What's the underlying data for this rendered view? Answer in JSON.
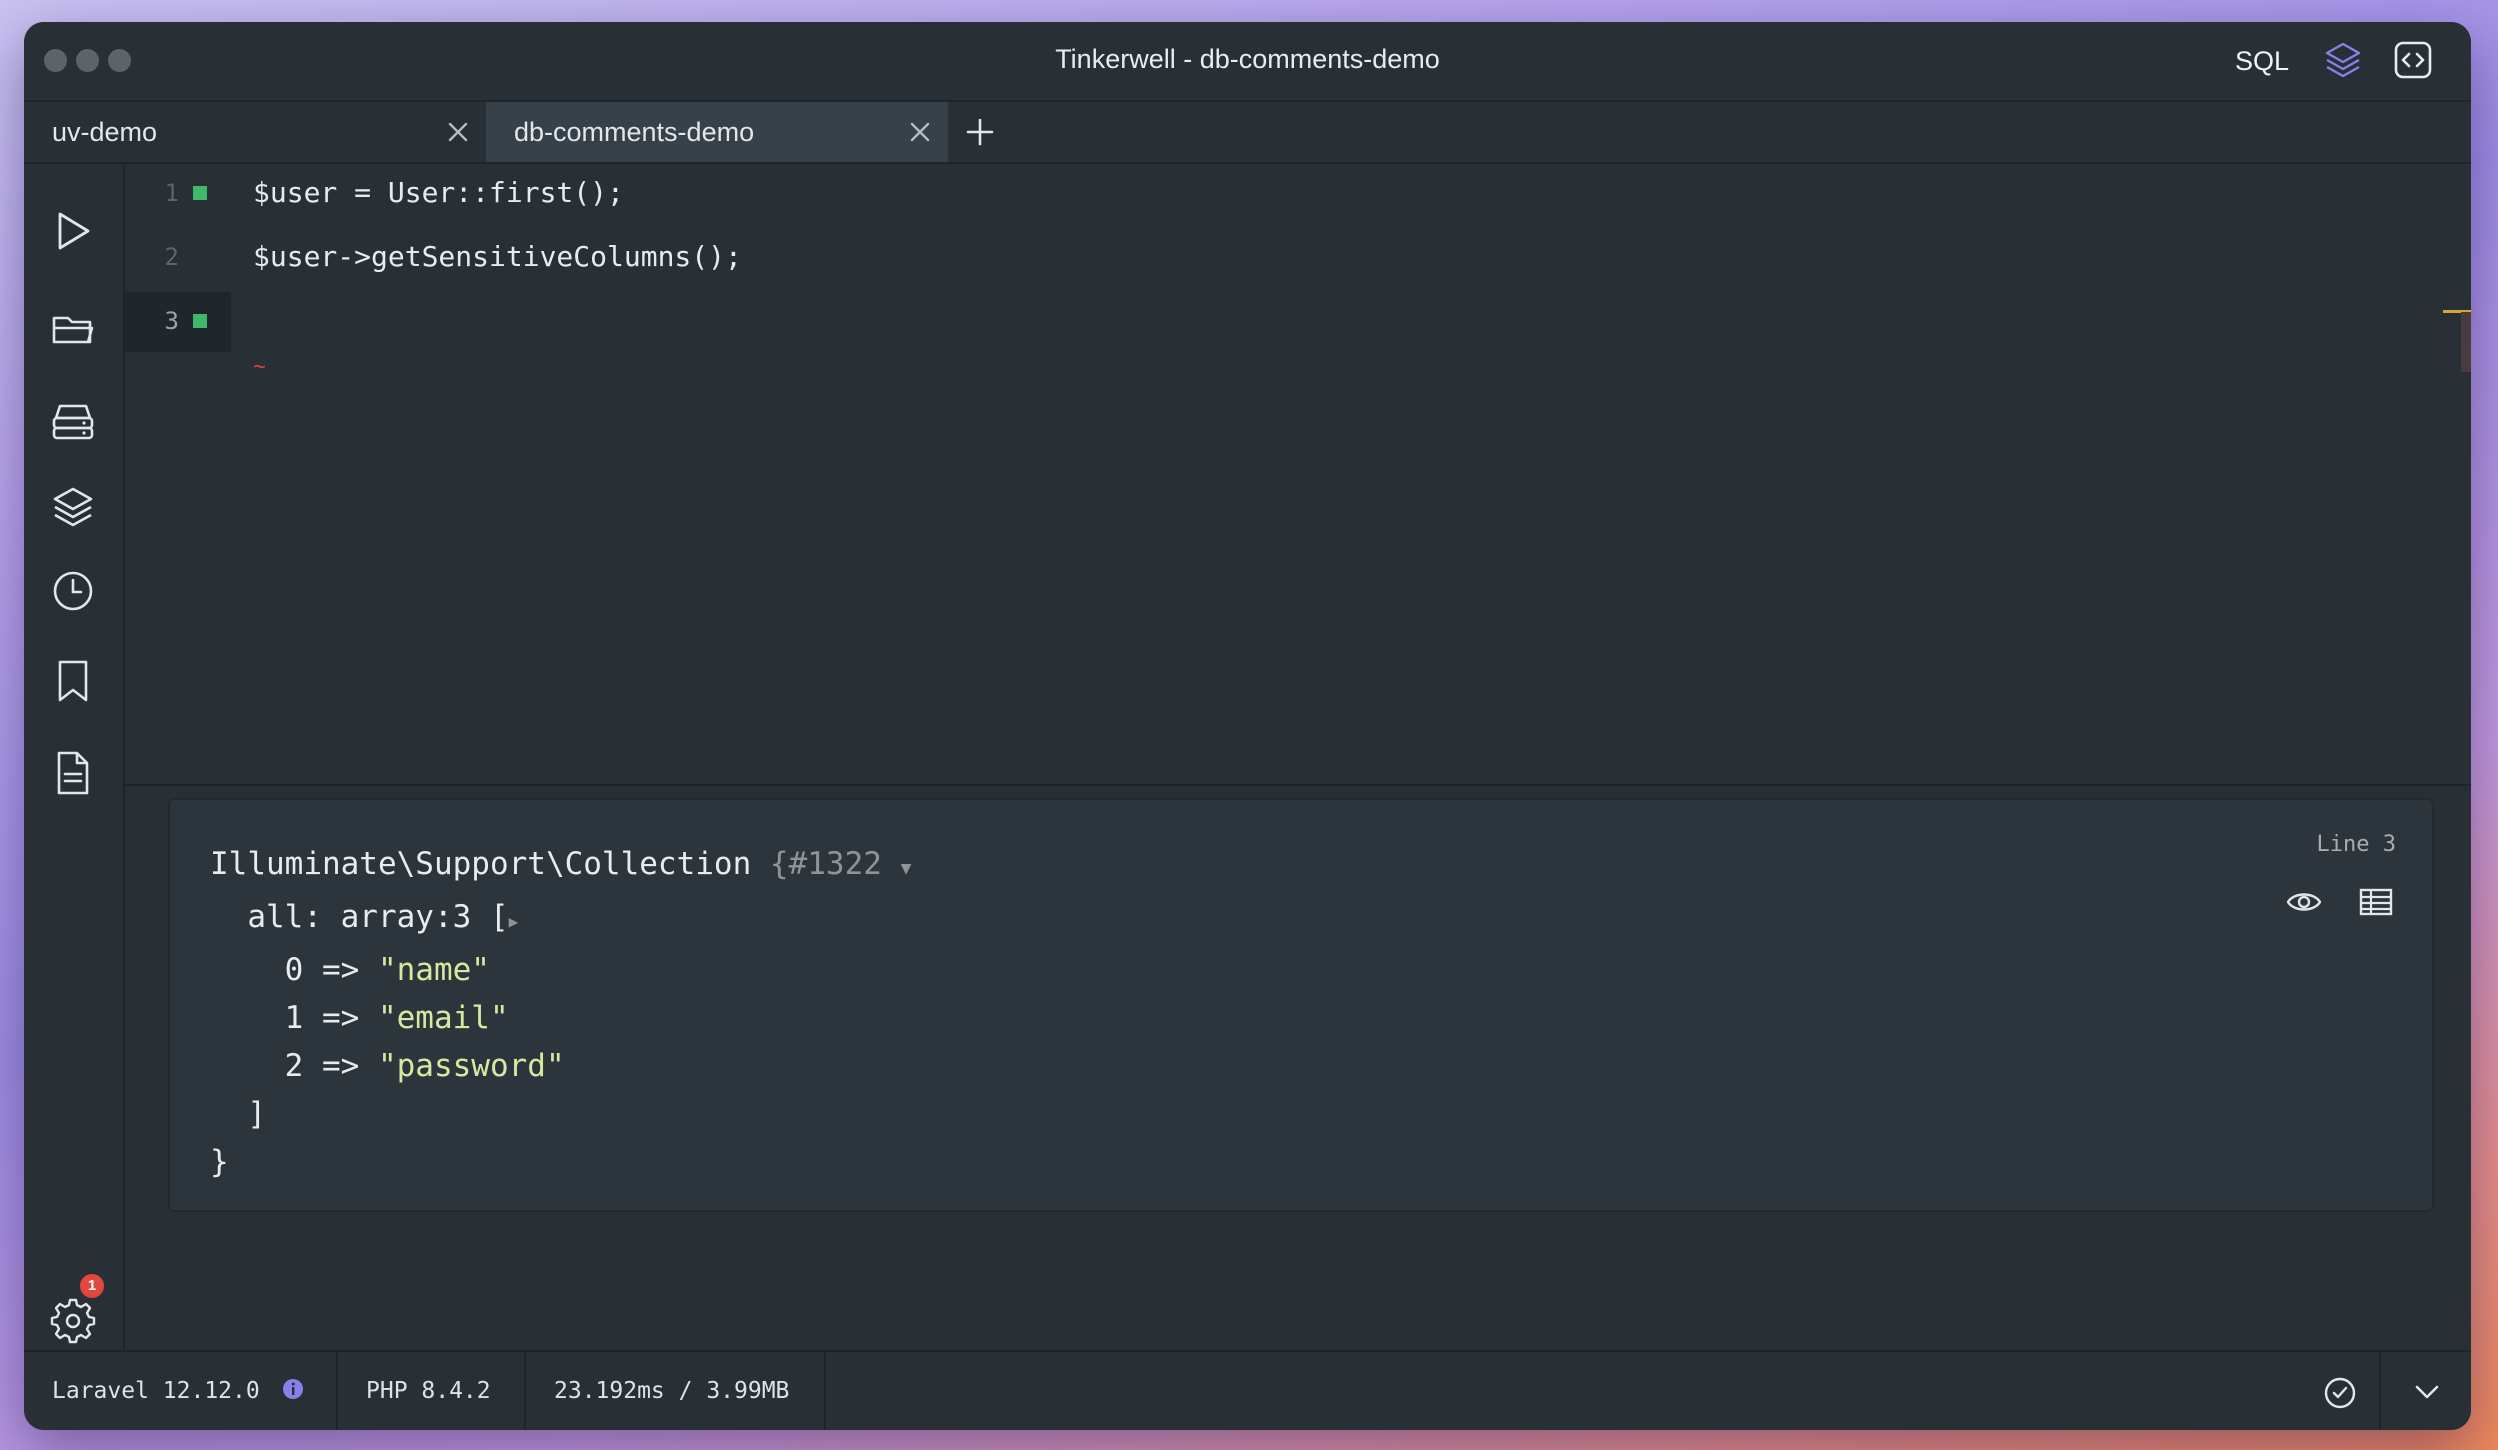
{
  "window": {
    "title": "Tinkerwell - db-comments-demo",
    "sql_label": "SQL"
  },
  "tabs": [
    {
      "label": "uv-demo"
    },
    {
      "label": "db-comments-demo"
    }
  ],
  "editor": {
    "lines": [
      {
        "number": "1",
        "code": "$user = User::first();"
      },
      {
        "number": "2",
        "code": "$user->getSensitiveColumns();"
      },
      {
        "number": "3",
        "code": ""
      }
    ]
  },
  "output": {
    "line_info": "Line 3",
    "class_name": "Illuminate\\Support\\Collection",
    "object_id": "{#1322",
    "prop": "all: array:3 [",
    "items": [
      {
        "key": "0",
        "value": "\"name\""
      },
      {
        "key": "1",
        "value": "\"email\""
      },
      {
        "key": "2",
        "value": "\"password\""
      }
    ],
    "close_bracket": "]",
    "close_brace": "}"
  },
  "settings_badge": "1",
  "status": {
    "laravel": "Laravel 12.12.0",
    "php": "PHP 8.4.2",
    "timing": "23.192ms / 3.99MB"
  },
  "colors": {
    "accent_green": "#3fb86b",
    "badge_red": "#e0483e",
    "info_purple": "#8b7fe8"
  }
}
